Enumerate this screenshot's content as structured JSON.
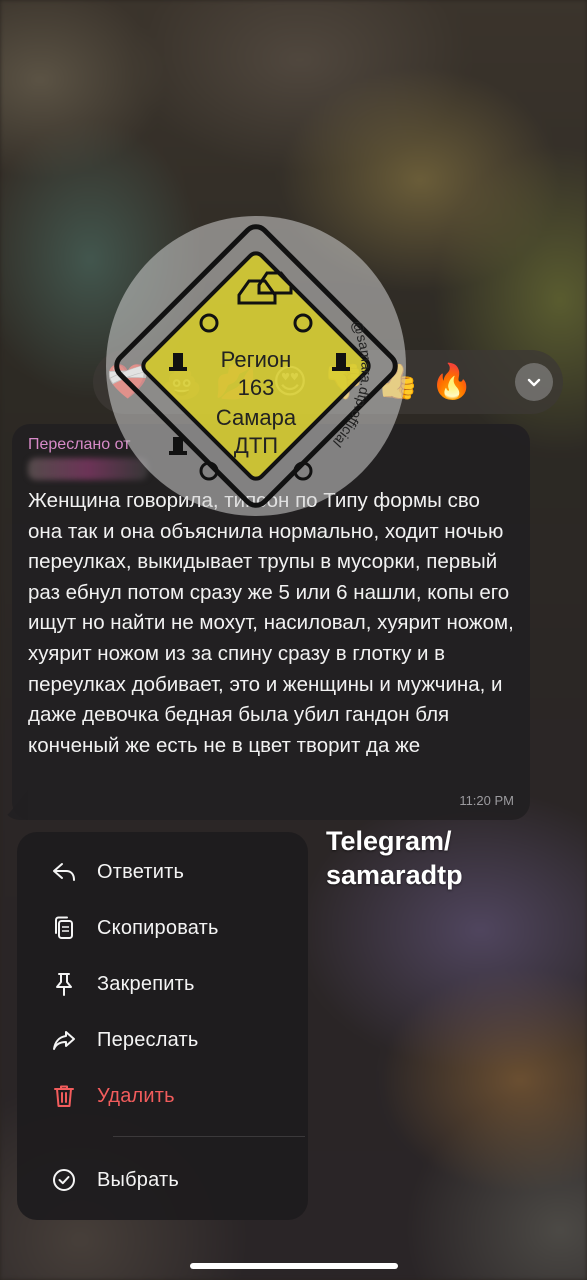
{
  "reactions": {
    "items": [
      {
        "emoji": "❤️‍🩹",
        "name": "mending-heart"
      },
      {
        "emoji": "💩",
        "name": "pile-of-poo"
      },
      {
        "emoji": "💋",
        "name": "kiss-mark"
      },
      {
        "emoji": "😍",
        "name": "heart-eyes"
      },
      {
        "emoji": "👎",
        "name": "thumbs-down"
      },
      {
        "emoji": "👍",
        "name": "thumbs-up"
      },
      {
        "emoji": "🔥",
        "name": "fire"
      }
    ],
    "expand_icon": "chevron-down-icon"
  },
  "message": {
    "forwarded_label": "Переслано от",
    "text": "Женщина говорила, типсон по Типу формы сво она так и она объяснила нормально, ходит ночью переулках, выкидывает трупы в мусорки, первый раз ебнул потом сразу же 5 или 6 нашли, копы его ищут но найти не мохут, насиловал, хуярит ножом, хуярит ножом из за спину сразу в глотку и в переулках добивает, это и женщины и мужчина, и даже девочка бедная была убил гандон бля конченый же есть не в цвет творит да же",
    "time": "11:20 PM"
  },
  "watermark": {
    "line1": "Регион",
    "line2": "163",
    "line3": "Самара",
    "line4": "ДТП",
    "handle": "@samara.dtp.official"
  },
  "caption": {
    "line1": "Telegram/",
    "line2": "samaradtp"
  },
  "menu": {
    "items": [
      {
        "label": "Ответить",
        "icon": "reply-icon"
      },
      {
        "label": "Скопировать",
        "icon": "copy-icon"
      },
      {
        "label": "Закрепить",
        "icon": "pin-icon"
      },
      {
        "label": "Переслать",
        "icon": "forward-icon"
      },
      {
        "label": "Удалить",
        "icon": "trash-icon",
        "danger": true
      },
      {
        "label": "Выбрать",
        "icon": "check-circle-icon"
      }
    ]
  },
  "colors": {
    "forwarded": "#d78ac8",
    "danger": "#f25c5c",
    "time": "#9b9a9e"
  }
}
